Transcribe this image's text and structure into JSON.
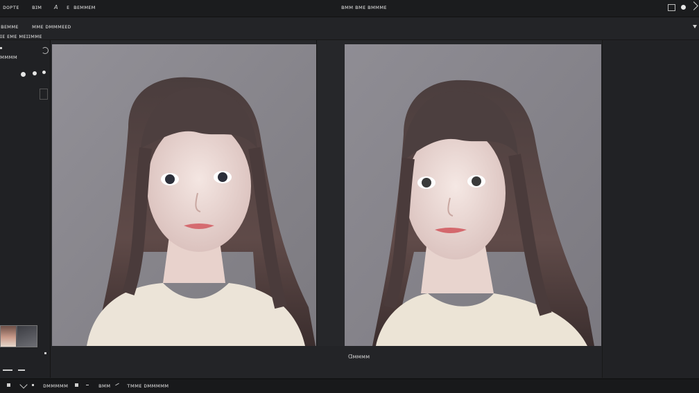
{
  "menubar": {
    "items": [
      "ᴅᴏᴘᴛᴇ",
      "ʙɪᴍ",
      "A",
      "ᴇ",
      "ʙᴇᴍᴍᴇᴍ"
    ],
    "center_title": "ʙᴍᴍ ʙᴍᴇ ʙᴍᴍᴍᴇ"
  },
  "optionsbar": {
    "left_label": "ʙᴇᴍᴍᴇ",
    "mid_label": "ᴍᴍᴇ ᴅᴍᴍᴍᴇᴇᴅ",
    "sub_label": "ɪᴇ ᴇᴍᴇ ᴍᴇɪɪᴍᴍᴇ"
  },
  "leftpanel": {
    "label": "ᴍᴍᴍᴍ"
  },
  "caption": "Ɑᴍᴍᴍᴍ",
  "statusbar": {
    "items": [
      "ᴅᴍᴍᴍᴍᴍ",
      "ʙᴍᴍ",
      "ᴛᴍᴍᴇ ᴅᴍᴍᴍᴍᴍ"
    ]
  },
  "colors": {
    "bg": "#1f2022",
    "panel": "#26272a",
    "photo_bg": "#8c8a8f",
    "text": "#d4d4d4"
  }
}
